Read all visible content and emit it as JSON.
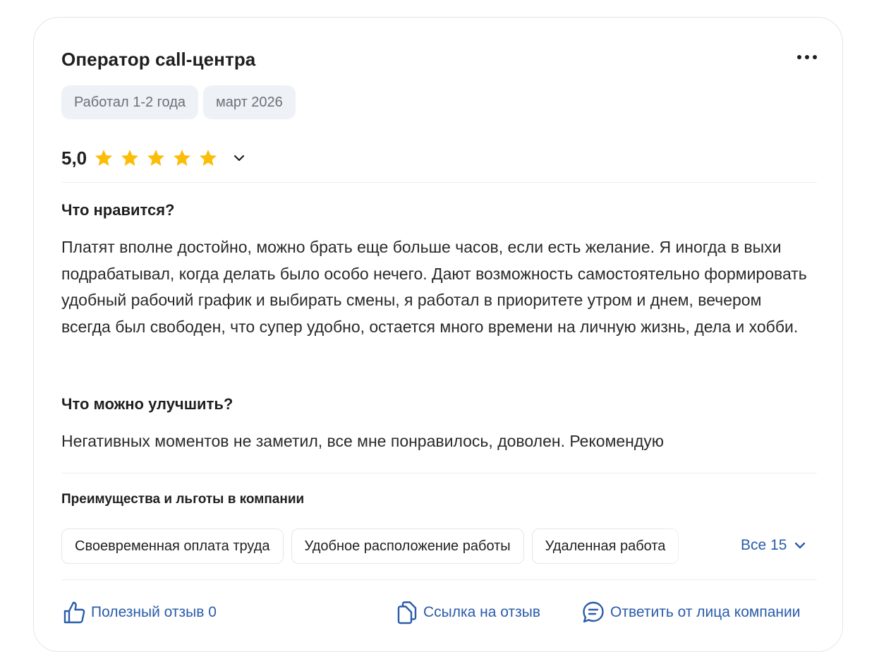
{
  "review": {
    "title": "Оператор call-центра",
    "meta_chips": [
      "Работал 1-2 года",
      "март 2026"
    ],
    "rating": {
      "value_text": "5,0",
      "stars": 5,
      "max_stars": 5
    },
    "likes_section": {
      "title": "Что нравится?",
      "text": "Платят вполне достойно, можно брать еще больше часов, если есть желание. Я иногда в выхи подрабатывал, когда делать было особо нечего. Дают возможность самостоятельно формировать удобный рабочий график и выбирать смены, я работал в приоритете утром и днем, вечером всегда был свободен, что супер удобно, остается много времени на личную жизнь, дела и хобби."
    },
    "improve_section": {
      "title": "Что можно улучшить?",
      "text": "Негативных моментов не заметил, все мне понравилось, доволен. Рекомендую"
    },
    "benefits": {
      "title": "Преимущества и льготы в компании",
      "items": [
        "Своевременная оплата труда",
        "Удобное расположение работы",
        "Удаленная работа"
      ],
      "all_label": "Все 15"
    },
    "footer": {
      "helpful_label": "Полезный отзыв 0",
      "link_label": "Ссылка на отзыв",
      "reply_label": "Ответить от лица компании"
    }
  },
  "colors": {
    "star": "#fbbd08",
    "link": "#2a5caa",
    "chip_bg": "#eef1f5",
    "chip_text": "#6a717a",
    "border": "#e3e6ea"
  },
  "icons": {
    "more": "more-dots-icon",
    "star": "star-icon",
    "expand": "chevron-down-icon",
    "helpful": "thumbs-up-icon",
    "link": "copy-link-icon",
    "reply": "chat-bubble-icon"
  }
}
